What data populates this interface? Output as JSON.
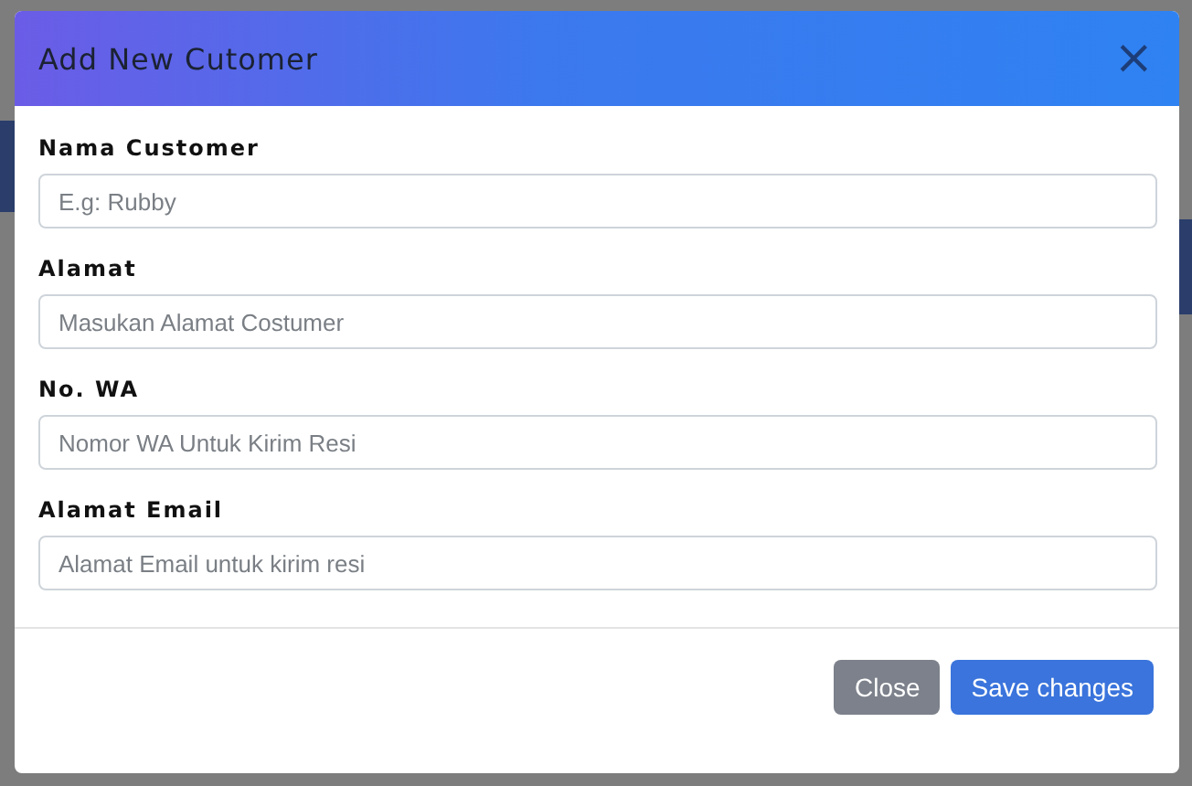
{
  "modal": {
    "title": "Add New Cutomer",
    "close_icon": "×",
    "fields": [
      {
        "label": "Nama Customer",
        "placeholder": "E.g: Rubby"
      },
      {
        "label": "Alamat",
        "placeholder": "Masukan Alamat Costumer"
      },
      {
        "label": "No. WA",
        "placeholder": "Nomor WA Untuk Kirim Resi"
      },
      {
        "label": "Alamat Email",
        "placeholder": "Alamat Email untuk kirim resi"
      }
    ],
    "buttons": [
      {
        "label": "Close",
        "kind": "secondary"
      },
      {
        "label": "Save changes",
        "kind": "primary"
      }
    ]
  }
}
